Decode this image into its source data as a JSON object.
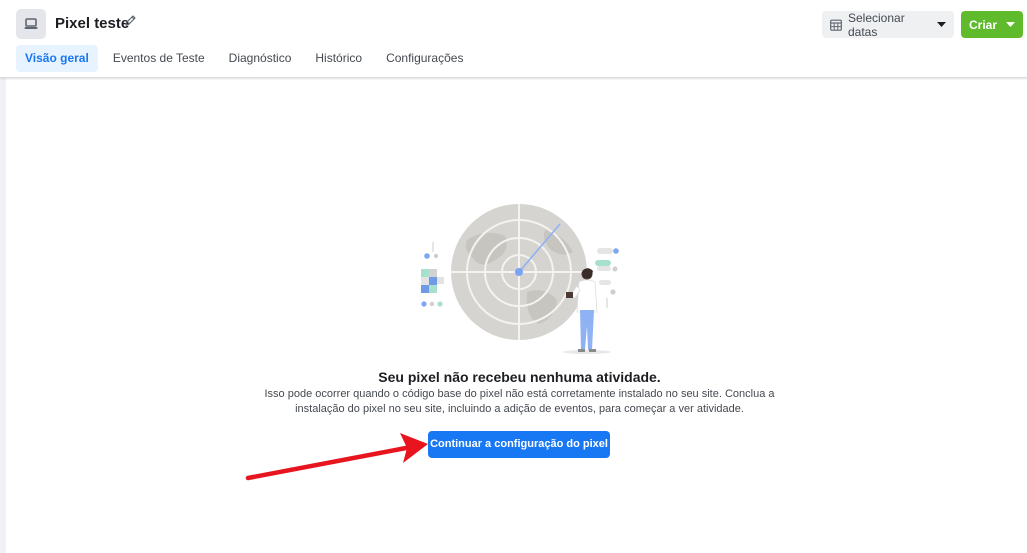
{
  "header": {
    "title": "Pixel teste",
    "date_button_label": "Selecionar datas",
    "create_button_label": "Criar"
  },
  "tabs": [
    {
      "label": "Visão geral",
      "active": true
    },
    {
      "label": "Eventos de Teste",
      "active": false
    },
    {
      "label": "Diagnóstico",
      "active": false
    },
    {
      "label": "Histórico",
      "active": false
    },
    {
      "label": "Configurações",
      "active": false
    }
  ],
  "empty_state": {
    "title": "Seu pixel não recebeu nenhuma atividade.",
    "body": "Isso pode ocorrer quando o código base do pixel não está corretamente instalado no seu site. Conclua a instalação do pixel no seu site, incluindo a adição de eventos, para começar a ver atividade.",
    "cta_label": "Continuar a configuração do pixel"
  },
  "icons": {
    "pixel": "monitor-icon",
    "edit": "pencil-icon",
    "calendar": "calendar-icon",
    "dropdown": "caret-down-icon",
    "annotation": "red-arrow-icon"
  },
  "colors": {
    "primary_blue": "#1877f2",
    "create_green": "#5fbb2b",
    "active_tab_bg": "#e7f3ff",
    "annotation_red": "#e8141e"
  }
}
